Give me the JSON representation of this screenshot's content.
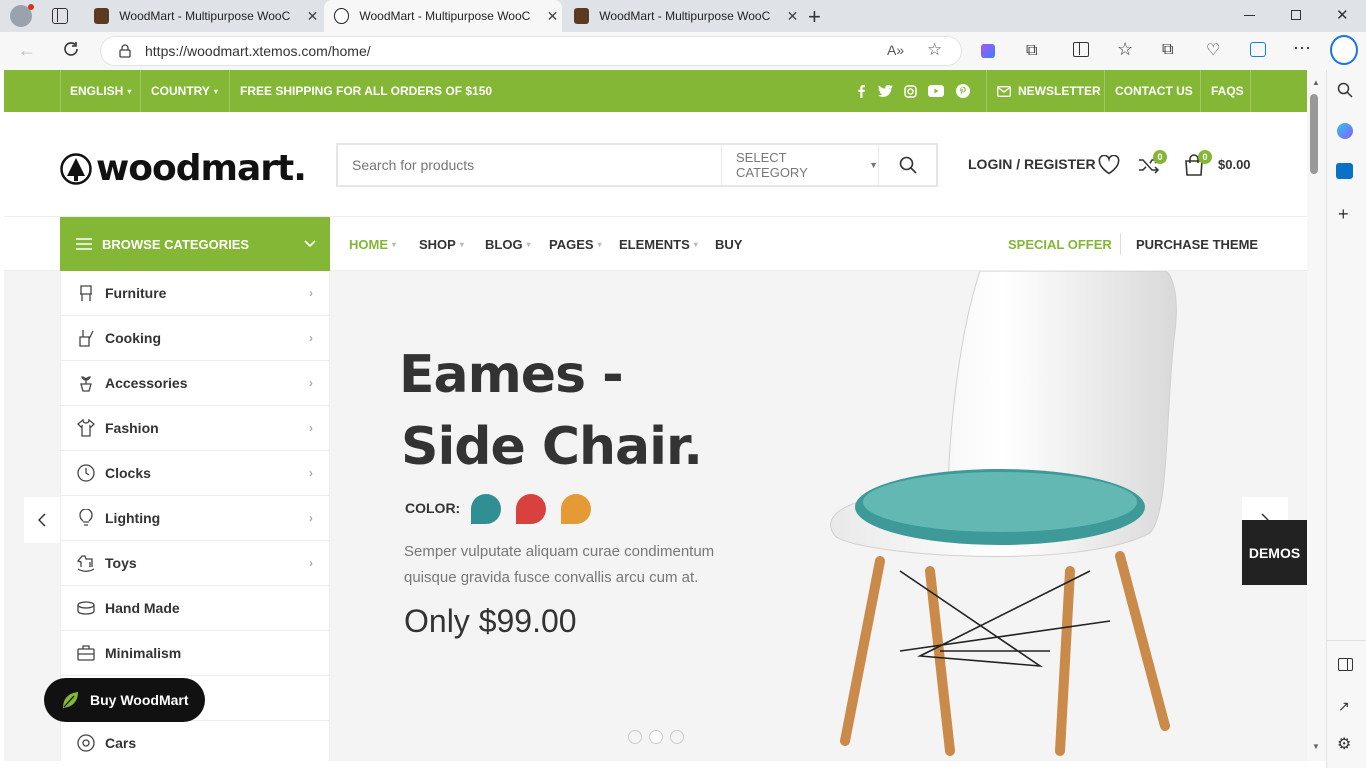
{
  "browser": {
    "tabs": [
      {
        "title": "WoodMart - Multipurpose WooC",
        "active": false
      },
      {
        "title": "WoodMart - Multipurpose WooC",
        "active": true
      },
      {
        "title": "WoodMart - Multipurpose WooC",
        "active": false
      }
    ],
    "url": "https://woodmart.xtemos.com/home/"
  },
  "topbar": {
    "language": "ENGLISH",
    "country": "COUNTRY",
    "shipping": "FREE SHIPPING FOR ALL ORDERS OF $150",
    "newsletter": "NEWSLETTER",
    "contact": "CONTACT US",
    "faqs": "FAQS",
    "social_icons": [
      "facebook-icon",
      "twitter-icon",
      "instagram-icon",
      "youtube-icon",
      "pinterest-icon"
    ]
  },
  "header": {
    "logo": "woodmart.",
    "search_placeholder": "Search for products",
    "select_category": "SELECT CATEGORY",
    "login": "LOGIN / REGISTER",
    "compare_count": "0",
    "cart_count": "0",
    "cart_total": "$0.00"
  },
  "nav": {
    "browse": "BROWSE CATEGORIES",
    "items": [
      "HOME",
      "SHOP",
      "BLOG",
      "PAGES",
      "ELEMENTS",
      "BUY"
    ],
    "special_offer": "SPECIAL OFFER",
    "purchase": "PURCHASE THEME"
  },
  "categories": [
    "Furniture",
    "Cooking",
    "Accessories",
    "Fashion",
    "Clocks",
    "Lighting",
    "Toys",
    "Hand Made",
    "Minimalism",
    "",
    "Cars"
  ],
  "hero": {
    "title_line1": "Eames -",
    "title_line2": "Side Chair.",
    "color_label": "COLOR:",
    "description_line1": "Semper vulputate aliquam curae condimentum",
    "description_line2": "quisque gravida fusce convallis arcu cum at.",
    "price": "Only $99.00",
    "swatches": [
      "#2f8f93",
      "#d9413f",
      "#e69a35"
    ]
  },
  "buy_button": "Buy WoodMart",
  "demos": "DEMOS",
  "colors": {
    "accent": "#83b735"
  }
}
